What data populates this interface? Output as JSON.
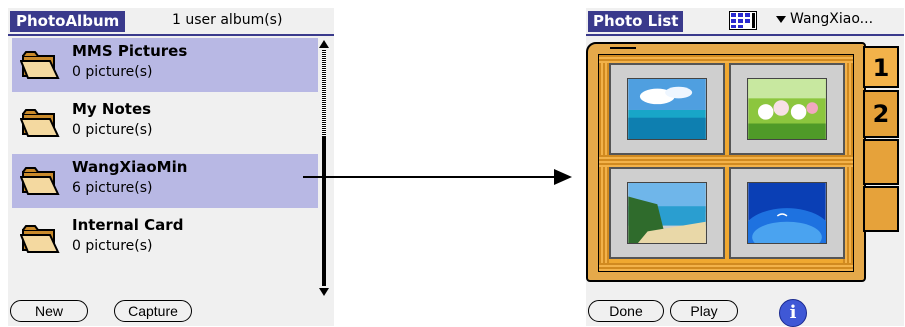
{
  "left": {
    "title": "PhotoAlbum",
    "info": "1 user album(s)",
    "albums": [
      {
        "name": "MMS Pictures",
        "count": "0 picture(s)",
        "selected": true
      },
      {
        "name": "My Notes",
        "count": "0 picture(s)",
        "selected": false
      },
      {
        "name": "WangXiaoMin",
        "count": "6 picture(s)",
        "selected": true
      },
      {
        "name": "Internal Card",
        "count": "0 picture(s)",
        "selected": false
      }
    ],
    "buttons": {
      "new": "New",
      "capture": "Capture"
    }
  },
  "right": {
    "title": "Photo List",
    "album_select": "WangXiao...",
    "page_tabs": [
      "1",
      "2",
      "",
      ""
    ],
    "active_page": "1",
    "buttons": {
      "done": "Done",
      "play": "Play",
      "info": "i"
    }
  },
  "icons": {
    "folder": "folder-icon",
    "view": "thumbnail-view-icon",
    "info": "info-icon"
  },
  "colors": {
    "title_tab": "#3a3a8c",
    "selected_row": "#b8b8e4",
    "book": "#e5a94a",
    "info_button": "#3f58d6"
  }
}
